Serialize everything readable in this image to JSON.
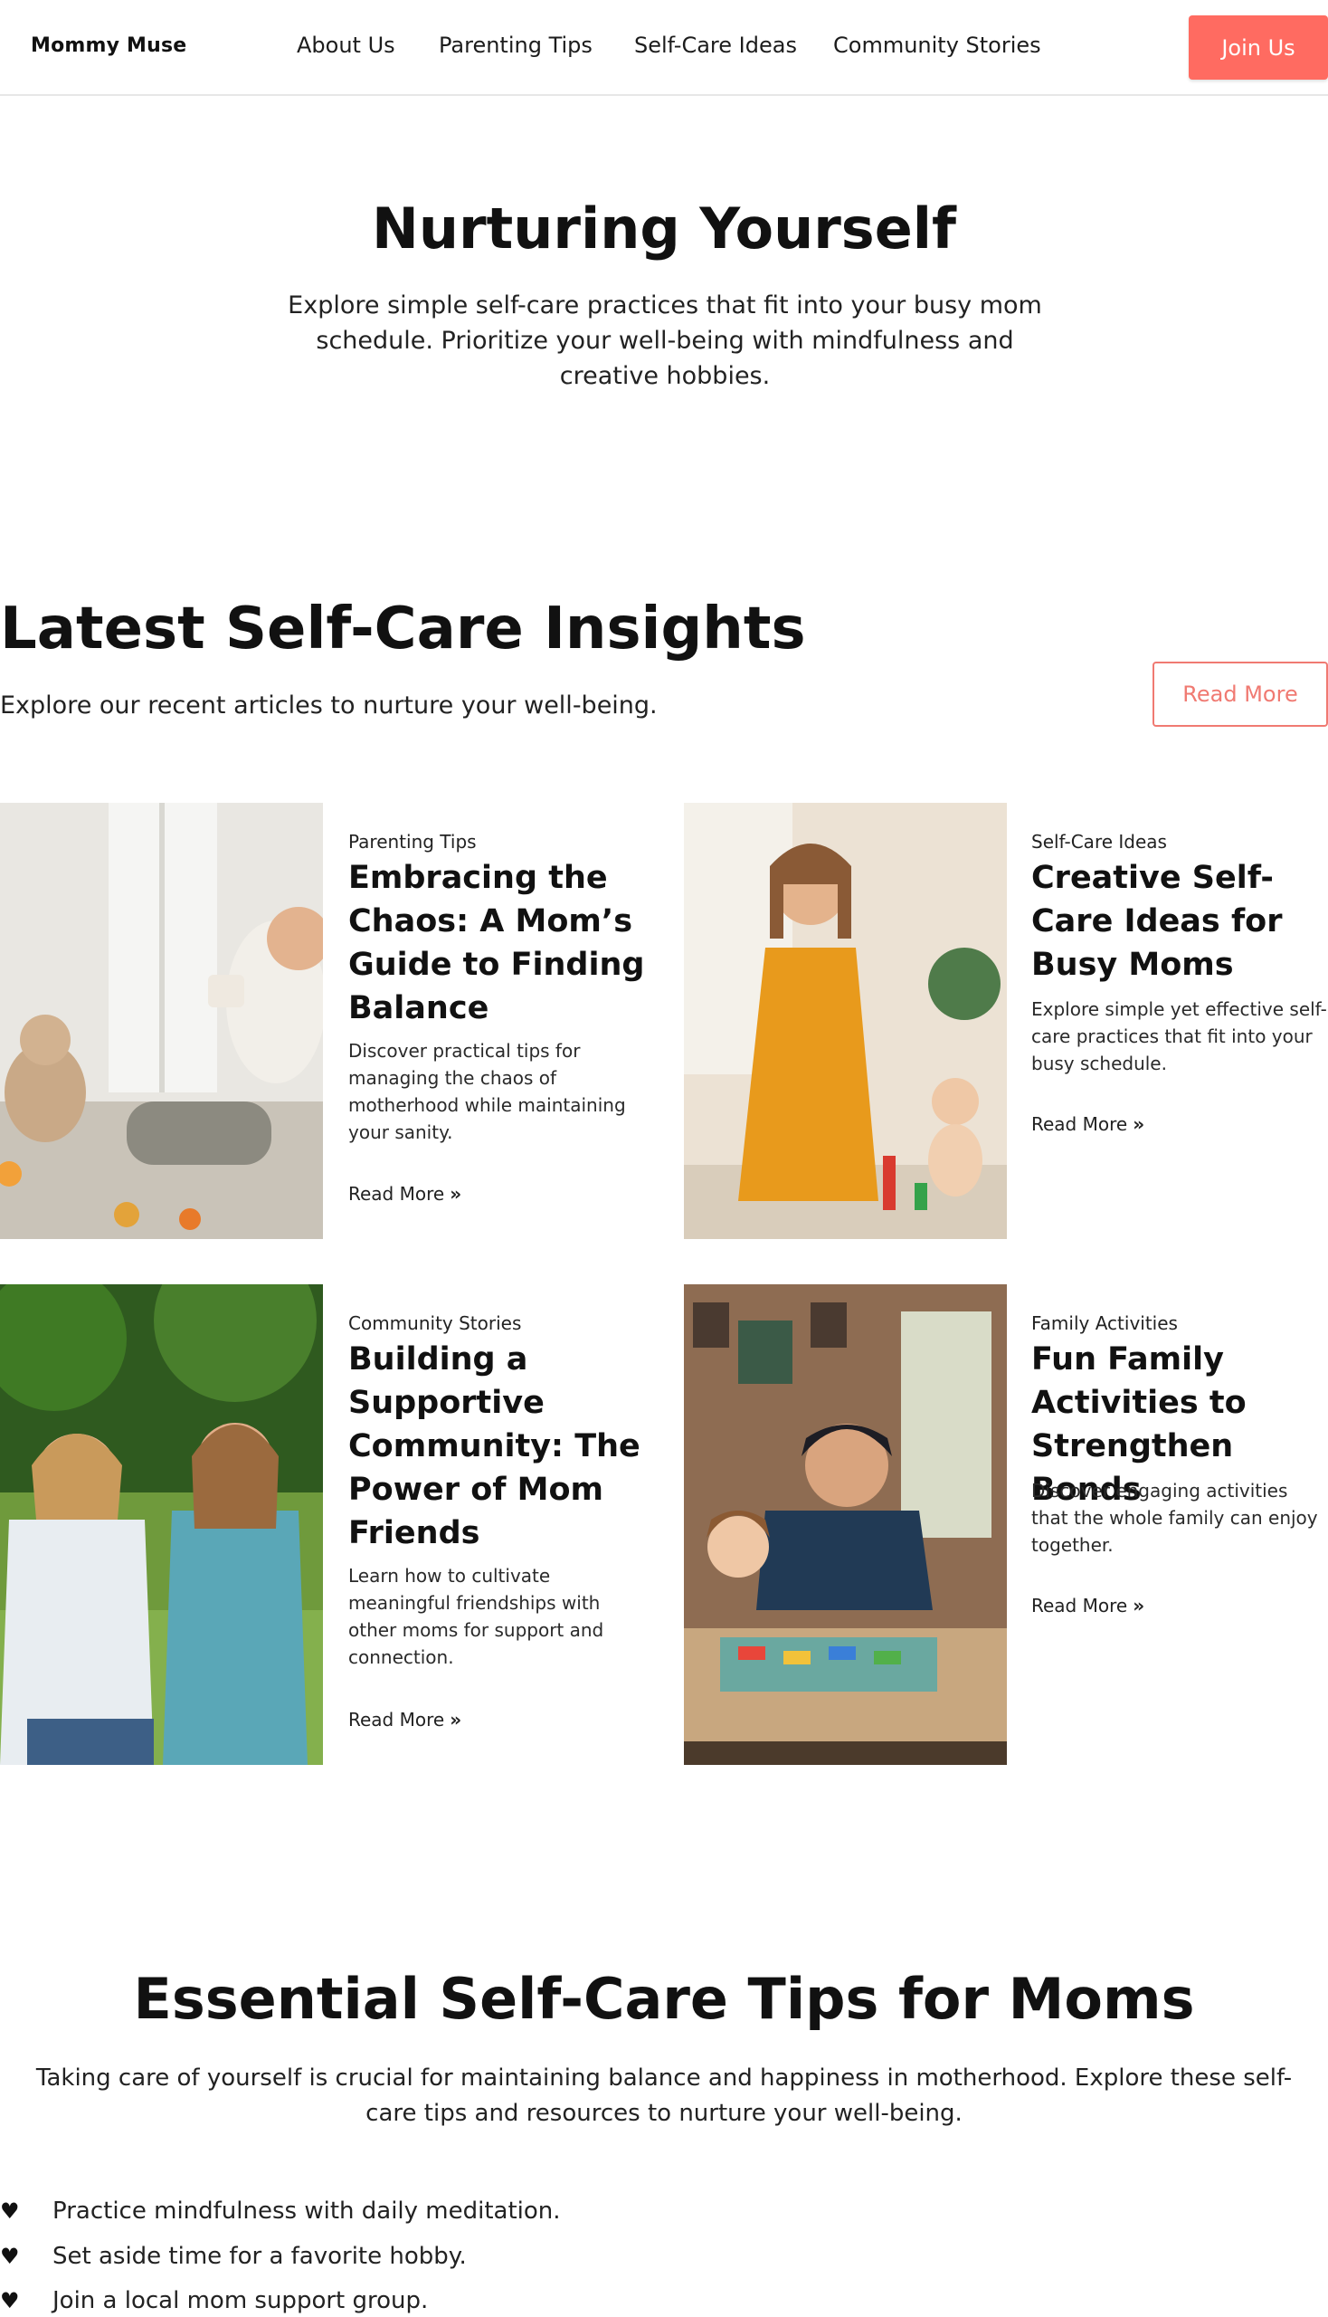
{
  "header": {
    "logo": "Mommy Muse",
    "nav": [
      "About Us",
      "Parenting Tips",
      "Self-Care Ideas",
      "Community Stories"
    ],
    "join_label": "Join Us",
    "accent": "#ff6b61"
  },
  "hero": {
    "title": "Nurturing Yourself",
    "subtitle": "Explore simple self-care practices that fit into your busy mom schedule. Prioritize your well-being with mindfulness and creative hobbies."
  },
  "insights": {
    "title": "Latest Self-Care Insights",
    "subtitle": "Explore our recent articles to nurture your well-being.",
    "read_more_label": "Read More",
    "cards": [
      {
        "category": "Parenting Tips",
        "title": "Embracing the Chaos: A Mom’s Guide to Finding Balance",
        "description": "Discover practical tips for managing the chaos of motherhood while maintaining your sanity.",
        "link": "Read More",
        "image": "mom-with-coffee-photo"
      },
      {
        "category": "Self-Care Ideas",
        "title": "Creative Self-Care Ideas for Busy Moms",
        "description": "Explore simple yet effective self-care practices that fit into your busy schedule.",
        "link": "Read More",
        "image": "mom-with-baby-photo"
      },
      {
        "category": "Community Stories",
        "title": "Building a Supportive Community: The Power of Mom Friends",
        "description": "Learn how to cultivate meaningful friendships with other moms for support and connection.",
        "link": "Read More",
        "image": "mom-friends-photo"
      },
      {
        "category": "Family Activities",
        "title": "Fun Family Activities to Strengthen Bonds",
        "description": "Discover engaging activities that the whole family can enjoy together.",
        "link": "Read More",
        "image": "family-board-game-photo"
      }
    ]
  },
  "tips": {
    "title": "Essential Self-Care Tips for Moms",
    "subtitle": "Taking care of yourself is crucial for maintaining balance and happiness in motherhood. Explore these self-care tips and resources to nurture your well-being.",
    "items": [
      "Practice mindfulness with daily meditation.",
      "Set aside time for a favorite hobby.",
      "Join a local mom support group."
    ]
  }
}
